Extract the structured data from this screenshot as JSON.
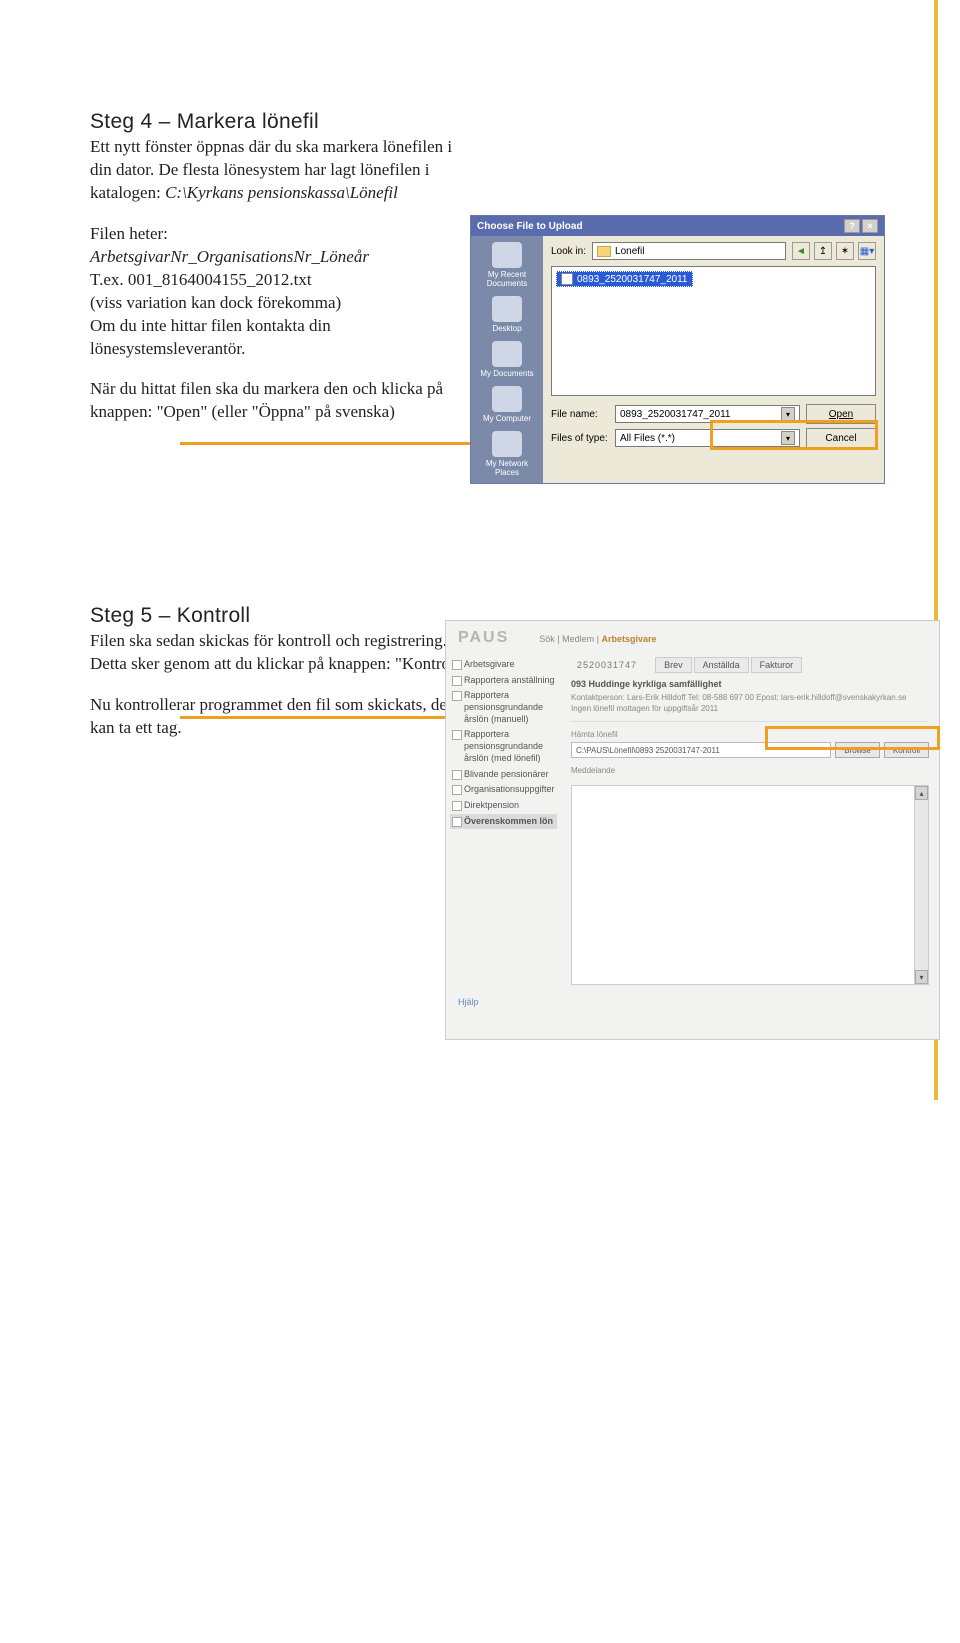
{
  "step4": {
    "title": "Steg 4 – Markera lönefil",
    "p1": "Ett nytt fönster öppnas där du ska markera lönefilen i din dator. De flesta lönesystem har lagt lönefilen i katalogen: ",
    "path": "C:\\Kyrkans pensionskassa\\Lönefil",
    "p2a": "Filen heter:",
    "p2b": "ArbetsgivarNr_OrganisationsNr_Löneår",
    "p2c": "T.ex. 001_8164004155_2012.txt",
    "p2d": "(viss variation kan dock förekomma)",
    "p2e": "Om du inte hittar filen kontakta din lönesystemsleverantör.",
    "p3": "När du hittat filen ska du markera den och klicka på knappen: \"Open\" (eller \"Öppna\" på svenska)"
  },
  "step5": {
    "title": "Steg 5 – Kontroll",
    "p1": "Filen ska sedan skickas för kontroll och registrering. Detta sker genom att du klickar på knappen: \"Kontroll\"",
    "p2": "Nu kontrollerar programmet den fil som skickats, det kan ta ett tag."
  },
  "fileDialog": {
    "title": "Choose File to Upload",
    "lookInLabel": "Look in:",
    "lookInValue": "Lonefil",
    "fileItem": "0893_2520031747_2011",
    "fileNameLabel": "File name:",
    "fileNameValue": "0893_2520031747_2011",
    "fileTypeLabel": "Files of type:",
    "fileTypeValue": "All Files (*.*)",
    "openLabel": "Open",
    "cancelLabel": "Cancel",
    "side": [
      "My Recent Documents",
      "Desktop",
      "My Documents",
      "My Computer",
      "My Network Places"
    ]
  },
  "paus": {
    "logo": "PAUS",
    "bc1": "Sök",
    "bc2": "Medlem",
    "bc3": "Arbetsgivare",
    "menu": [
      "Arbetsgivare",
      "Rapportera anställning",
      "Rapportera pensionsgrundande årslön (manuell)",
      "Rapportera pensionsgrundande årslön (med lönefil)",
      "Blivande pensionärer",
      "Organisationsuppgifter",
      "Direktpension",
      "Överenskommen lön"
    ],
    "orgId": "2520031747",
    "tabs": [
      "Brev",
      "Anställda",
      "Fakturor"
    ],
    "orgName": "093 Huddinge kyrkliga samfällighet",
    "contactLine": "Kontaktperson: Lars-Erik Hilldoff Tel: 08-588 697 00 Epost: lars-erik.hilldoff@svenskakyrkan.se",
    "statusLine": "Ingen lönefil mottagen för uppgiftsår 2011",
    "fileLabel": "Hämta lönefil",
    "filePath": "C:\\PAUS\\Lönefil\\0893 2520031747-2011",
    "browseLabel": "Browse",
    "kontrollLabel": "Kontroll",
    "msgLabel": "Meddelande",
    "helpLabel": "Hjälp"
  }
}
